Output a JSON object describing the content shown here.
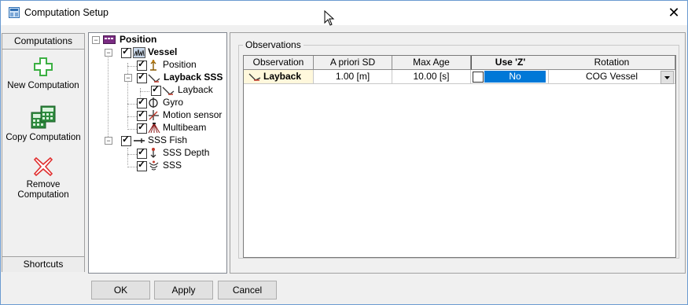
{
  "window": {
    "title": "Computation Setup",
    "close_glyph": "✕"
  },
  "leftbar": {
    "header": "Computations",
    "footer": "Shortcuts",
    "buttons": [
      {
        "label": "New Computation",
        "icon": "plus-icon"
      },
      {
        "label": "Copy Computation",
        "icon": "calculator-icon"
      },
      {
        "label": "Remove Computation",
        "icon": "remove-x-icon"
      }
    ]
  },
  "tree": {
    "root": "Position",
    "vessel": "Vessel",
    "position": "Position",
    "layback_sss": "Layback SSS",
    "layback": "Layback",
    "gyro": "Gyro",
    "motion_sensor": "Motion sensor",
    "multibeam": "Multibeam",
    "sss_fish": "SSS Fish",
    "sss_depth": "SSS Depth",
    "sss": "SSS"
  },
  "observations": {
    "group_label": "Observations",
    "columns": [
      "Observation",
      "A priori SD",
      "Max Age",
      "Use 'Z'",
      "Rotation"
    ],
    "row": {
      "observation": "Layback",
      "a_priori_sd": "1.00 [m]",
      "max_age": "10.00 [s]",
      "use_z": "No",
      "rotation": "COG Vessel"
    }
  },
  "buttons": {
    "ok": "OK",
    "apply": "Apply",
    "cancel": "Cancel"
  },
  "colors": {
    "accent": "#0078d7",
    "selected_cell": "#fff8dc"
  }
}
